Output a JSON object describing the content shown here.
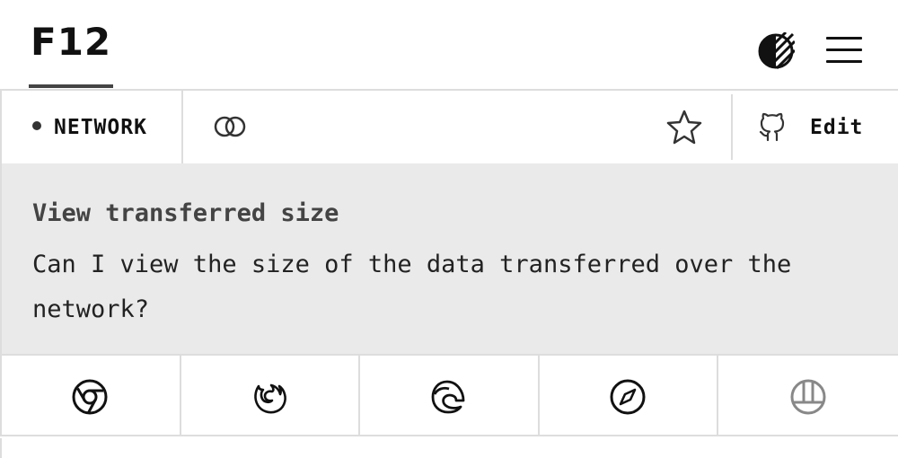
{
  "header": {
    "logo": "F12",
    "theme_icon": "contrast-icon",
    "menu_icon": "hamburger-menu-icon"
  },
  "toolbar": {
    "category": "NETWORK",
    "link_icon": "link-icon",
    "star_icon": "star-icon",
    "github_icon": "github-icon",
    "edit_label": "Edit"
  },
  "feature": {
    "title": "View transferred size",
    "description": "Can I view the size of the data transferred over the network?"
  },
  "browsers": [
    {
      "name": "chrome",
      "icon": "chrome-icon",
      "supported": true
    },
    {
      "name": "firefox",
      "icon": "firefox-icon",
      "supported": true
    },
    {
      "name": "edge",
      "icon": "edge-icon",
      "supported": true
    },
    {
      "name": "safari",
      "icon": "safari-icon",
      "supported": true
    },
    {
      "name": "other",
      "icon": "polypane-icon",
      "supported": false
    }
  ],
  "colors": {
    "text": "#111111",
    "panel_bg": "#eaeaea",
    "border": "#dddddd",
    "muted_icon": "#888888"
  }
}
